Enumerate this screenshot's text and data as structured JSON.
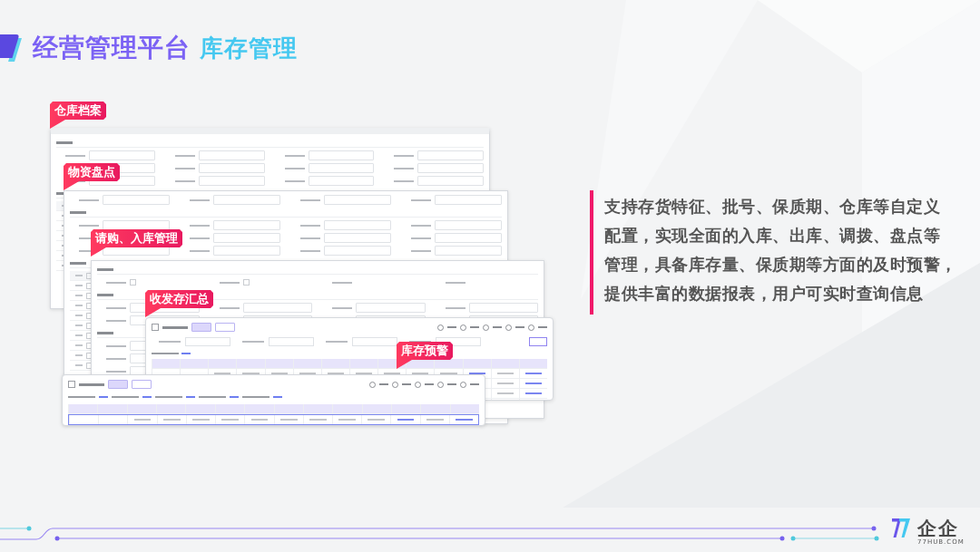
{
  "header": {
    "title": "经营管理平台",
    "subtitle": "库存管理"
  },
  "screenshots": [
    {
      "kind": "form",
      "callout": "仓库档案"
    },
    {
      "kind": "form",
      "callout": "物资盘点"
    },
    {
      "kind": "form",
      "callout": "请购、入库管理"
    },
    {
      "kind": "report",
      "callout": "收发存汇总"
    },
    {
      "kind": "report",
      "callout": "库存预警"
    }
  ],
  "description": [
    "支持存货特征、批号、保质期、仓库等自定义",
    "配置，实现全面的入库、出库、调拨、盘点等",
    "管理，具备库存量、保质期等方面的及时预警，",
    "提供丰富的数据报表，用户可实时查询信息"
  ],
  "footer": {
    "brand": "企企",
    "domain": "77HUB.COM"
  }
}
